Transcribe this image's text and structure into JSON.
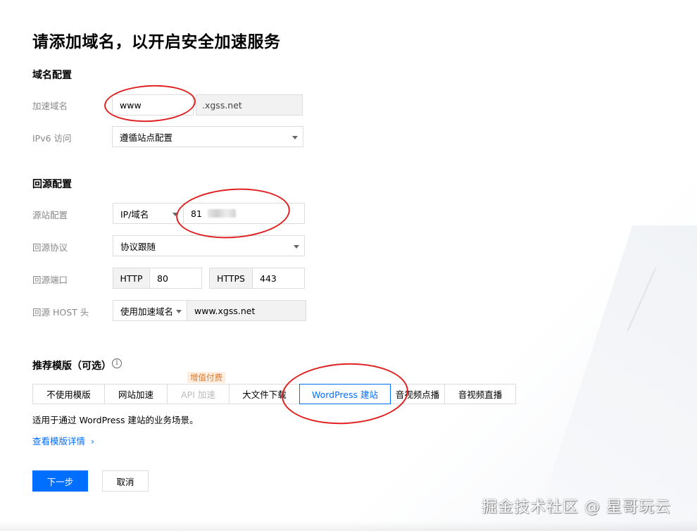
{
  "page_title": "请添加域名，以开启安全加速服务",
  "domain_config": {
    "section_title": "域名配置",
    "accel_domain_label": "加速域名",
    "accel_domain_value": "www",
    "domain_suffix": ".xgss.net",
    "ipv6_label": "IPv6 访问",
    "ipv6_value": "遵循站点配置"
  },
  "origin_config": {
    "section_title": "回源配置",
    "origin_label": "源站配置",
    "origin_type": "IP/域名",
    "origin_value": "81",
    "protocol_label": "回源协议",
    "protocol_value": "协议跟随",
    "port_label": "回源端口",
    "http_label": "HTTP",
    "http_port": "80",
    "https_label": "HTTPS",
    "https_port": "443",
    "host_label": "回源 HOST 头",
    "host_type": "使用加速域名",
    "host_value": "www.xgss.net"
  },
  "templates": {
    "section_title": "推荐模版（可选）",
    "info_icon": "info-circle-icon",
    "paid_badge": "增值付费",
    "tabs": [
      {
        "label": "不使用模版"
      },
      {
        "label": "网站加速"
      },
      {
        "label": "API 加速"
      },
      {
        "label": "大文件下载"
      },
      {
        "label": "WordPress 建站"
      },
      {
        "label": "音视频点播"
      },
      {
        "label": "音视频直播"
      }
    ],
    "selected": "WordPress 建站",
    "description": "适用于通过 WordPress 建站的业务场景。",
    "details_link": "查看模版详情",
    "details_icon": "chevron-right-icon"
  },
  "actions": {
    "next": "下一步",
    "cancel": "取消"
  },
  "watermark": "掘金技术社区 @ 星哥玩云",
  "colors": {
    "primary": "#006eff",
    "annotation_red": "#e02020",
    "badge_bg": "#fdeee0",
    "badge_text": "#e07a2f"
  }
}
